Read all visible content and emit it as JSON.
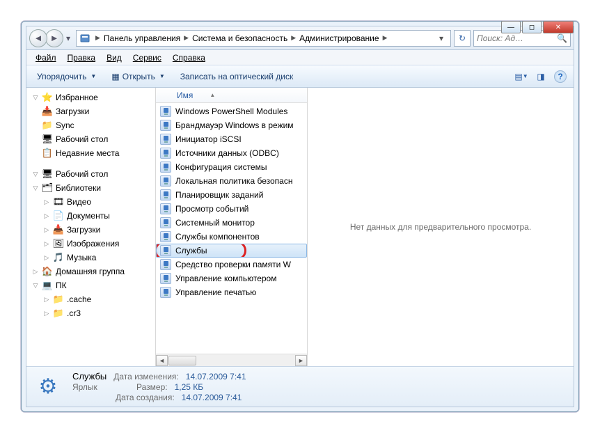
{
  "titlebar": {
    "min": "—",
    "max": "◻",
    "close": "✕"
  },
  "breadcrumbs": {
    "items": [
      "Панель управления",
      "Система и безопасность",
      "Администрирование"
    ]
  },
  "search": {
    "placeholder": "Поиск: Ад…"
  },
  "menu": {
    "file": "Файл",
    "edit": "Правка",
    "view": "Вид",
    "tools": "Сервис",
    "help": "Справка"
  },
  "toolbar": {
    "organize": "Упорядочить",
    "open": "Открыть",
    "burn": "Записать на оптический диск"
  },
  "column_header": "Имя",
  "sidebar": {
    "favorites": {
      "label": "Избранное",
      "items": [
        {
          "label": "Загрузки",
          "icon": "ico-download"
        },
        {
          "label": "Sync",
          "icon": "ico-sync"
        },
        {
          "label": "Рабочий стол",
          "icon": "ico-desktop"
        },
        {
          "label": "Недавние места",
          "icon": "ico-recent"
        }
      ]
    },
    "desktop": {
      "label": "Рабочий стол",
      "libraries": {
        "label": "Библиотеки",
        "items": [
          {
            "label": "Видео",
            "icon": "ico-video"
          },
          {
            "label": "Документы",
            "icon": "ico-doc"
          },
          {
            "label": "Загрузки",
            "icon": "ico-download"
          },
          {
            "label": "Изображения",
            "icon": "ico-image"
          },
          {
            "label": "Музыка",
            "icon": "ico-music"
          }
        ]
      },
      "homegroup": {
        "label": "Домашняя группа"
      },
      "pc": {
        "label": "ПК",
        "items": [
          {
            "label": ".cache",
            "icon": "ico-folder"
          },
          {
            "label": ".cr3",
            "icon": "ico-folder"
          }
        ]
      }
    }
  },
  "files": [
    {
      "label": "Windows PowerShell Modules",
      "selected": false
    },
    {
      "label": "Брандмауэр Windows в режим",
      "selected": false
    },
    {
      "label": "Инициатор iSCSI",
      "selected": false
    },
    {
      "label": "Источники данных (ODBC)",
      "selected": false
    },
    {
      "label": "Конфигурация системы",
      "selected": false
    },
    {
      "label": "Локальная политика безопасн",
      "selected": false
    },
    {
      "label": "Планировщик заданий",
      "selected": false
    },
    {
      "label": "Просмотр событий",
      "selected": false
    },
    {
      "label": "Системный монитор",
      "selected": false
    },
    {
      "label": "Службы компонентов",
      "selected": false
    },
    {
      "label": "Службы",
      "selected": true
    },
    {
      "label": "Средство проверки памяти W",
      "selected": false
    },
    {
      "label": "Управление компьютером",
      "selected": false
    },
    {
      "label": "Управление печатью",
      "selected": false
    }
  ],
  "preview": {
    "empty": "Нет данных для предварительного просмотра."
  },
  "details": {
    "name": "Службы",
    "type": "Ярлык",
    "modified_label": "Дата изменения:",
    "modified_value": "14.07.2009 7:41",
    "size_label": "Размер:",
    "size_value": "1,25 КБ",
    "created_label": "Дата создания:",
    "created_value": "14.07.2009 7:41"
  }
}
